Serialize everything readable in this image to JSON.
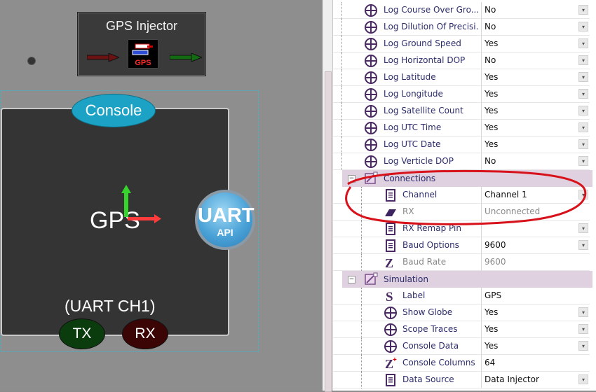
{
  "canvas": {
    "injector_title": "GPS Injector",
    "injector_icon_label": "GPS",
    "console_label": "Console",
    "gps_name": "GPS",
    "uart_top": "UART",
    "uart_bottom": "API",
    "channel_label": "(UART CH1)",
    "tx_label": "TX",
    "rx_label": "RX"
  },
  "properties": {
    "log_rows": [
      {
        "name": "Log Course Over Gro...",
        "value": "No"
      },
      {
        "name": "Log Dilution Of Precisi...",
        "value": "No"
      },
      {
        "name": "Log Ground Speed",
        "value": "Yes"
      },
      {
        "name": "Log Horizontal DOP",
        "value": "No"
      },
      {
        "name": "Log Latitude",
        "value": "Yes"
      },
      {
        "name": "Log Longitude",
        "value": "Yes"
      },
      {
        "name": "Log Satellite Count",
        "value": "Yes"
      },
      {
        "name": "Log UTC Time",
        "value": "Yes"
      },
      {
        "name": "Log UTC Date",
        "value": "Yes"
      },
      {
        "name": "Log Verticle DOP",
        "value": "No"
      }
    ],
    "connections": {
      "header": "Connections",
      "rows": [
        {
          "name": "Channel",
          "value": "Channel 1"
        },
        {
          "name": "RX",
          "value": "Unconnected"
        },
        {
          "name": "RX Remap Pin",
          "value": ""
        },
        {
          "name": "Baud Options",
          "value": "9600"
        },
        {
          "name": "Baud Rate",
          "value": "9600"
        }
      ]
    },
    "simulation": {
      "header": "Simulation",
      "rows": [
        {
          "name": "Label",
          "value": "GPS"
        },
        {
          "name": "Show Globe",
          "value": "Yes"
        },
        {
          "name": "Scope Traces",
          "value": "Yes"
        },
        {
          "name": "Console Data",
          "value": "Yes"
        },
        {
          "name": "Console Columns",
          "value": "64"
        },
        {
          "name": "Data Source",
          "value": "Data Injector"
        }
      ]
    }
  },
  "colors": {
    "accent_console": "#1ba2c4",
    "category_bg": "#dfd1df",
    "annotation_red": "#d8121b"
  }
}
